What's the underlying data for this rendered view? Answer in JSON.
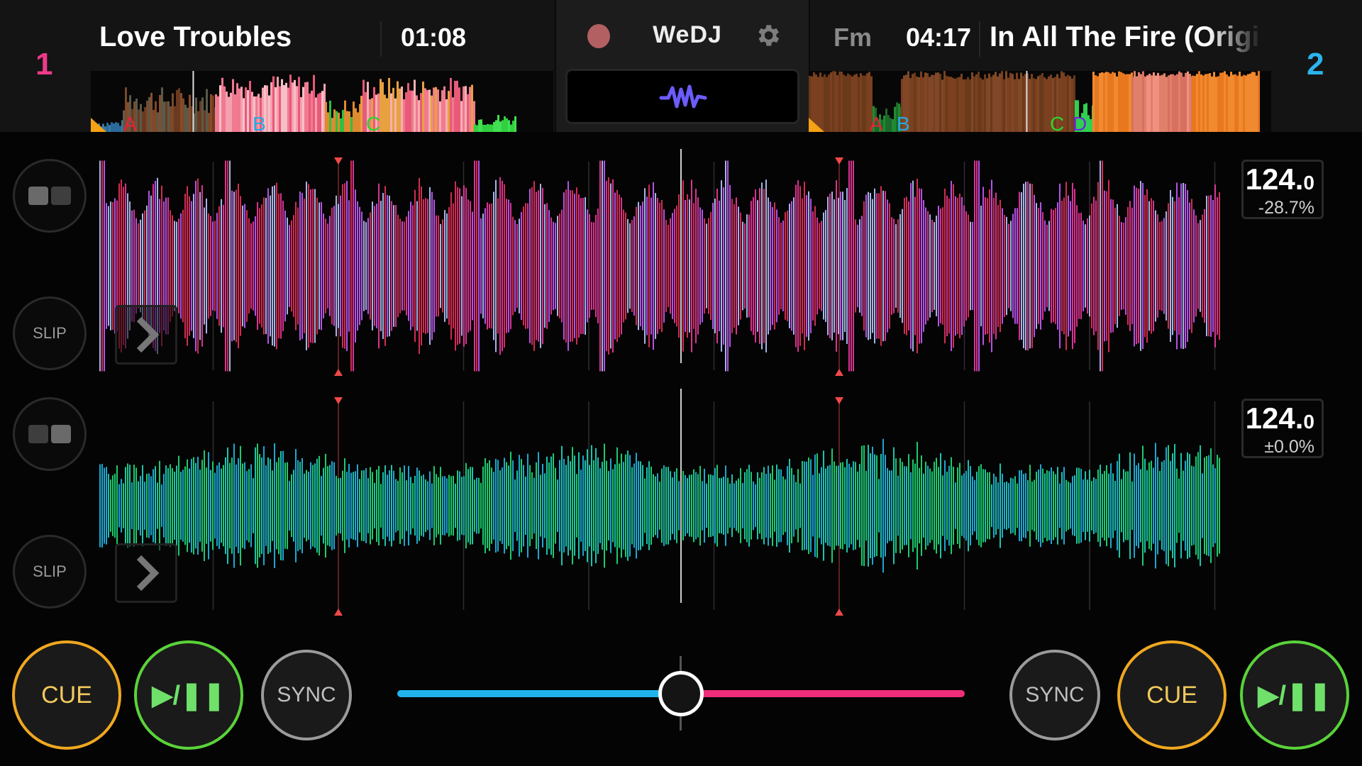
{
  "app": {
    "name": "WeDJ"
  },
  "center_panel": {
    "record_icon": "record-icon",
    "settings_icon": "gear-icon",
    "waveform_toggle_icon": "waveform-icon",
    "record_color": "#b36062",
    "waveform_icon_color": "#6c5cff"
  },
  "deck1": {
    "number": "1",
    "number_color": "#ef3a8a",
    "title": "Love Troubles",
    "time": "01:08",
    "key": "",
    "bpm": "124.",
    "bpm_decimal": "0",
    "pitch": "-28.7%",
    "overview_cues": [
      {
        "label": "A",
        "color": "#e8203c"
      },
      {
        "label": "B",
        "color": "#2aa8e0"
      },
      {
        "label": "C",
        "color": "#2bd62b"
      }
    ],
    "split_icon": "split-view-left-icon",
    "slip_label": "SLIP",
    "jump_icon": "chevron-right-icon",
    "waveform_colors": [
      "#e8325a",
      "#f03aa0",
      "#c85cff",
      "#b9c8ff"
    ],
    "cue_label": "CUE",
    "play_label": "▶/❚❚",
    "sync_label": "SYNC"
  },
  "deck2": {
    "number": "2",
    "number_color": "#2ab4ef",
    "title": "In All The Fire (Origin",
    "time": "04:17",
    "key": "Fm",
    "bpm": "124.",
    "bpm_decimal": "0",
    "pitch": "±0.0%",
    "overview_cues": [
      {
        "label": "A",
        "color": "#e8203c"
      },
      {
        "label": "B",
        "color": "#2aa8e0"
      },
      {
        "label": "C",
        "color": "#2bd62b"
      },
      {
        "label": "D",
        "color": "#6a2cd8"
      }
    ],
    "split_icon": "split-view-right-icon",
    "slip_label": "SLIP",
    "jump_icon": "chevron-right-icon",
    "waveform_colors": [
      "#1fe07a",
      "#1fd8c0",
      "#22b8e8"
    ],
    "cue_label": "CUE",
    "play_label": "▶/❚❚",
    "sync_label": "SYNC"
  },
  "crossfader": {
    "position": 0.5,
    "left_color": "#21b4ec",
    "right_color": "#ef2d78"
  },
  "deck1_overview_position": 0.22,
  "deck2_overview_position": 0.47
}
